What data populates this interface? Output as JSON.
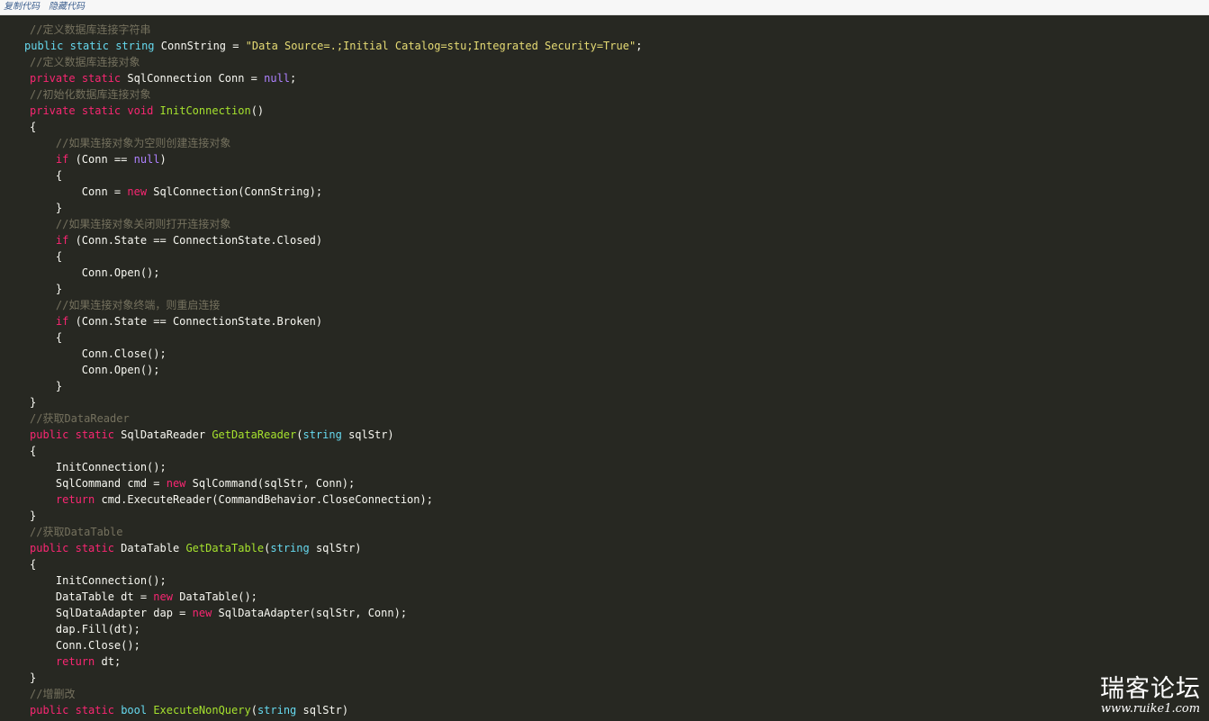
{
  "toolbar": {
    "copy_label": "复制代码",
    "hide_label": "隐藏代码"
  },
  "colors": {
    "background": "#272822",
    "keyword": "#f92672",
    "type": "#66d9ef",
    "string": "#e6db74",
    "function": "#a6e22e",
    "comment": "#75715e",
    "literal": "#ae81ff",
    "plain": "#f8f8f2"
  },
  "code": {
    "language": "csharp",
    "lines": [
      [
        [
          "cm",
          "//定义数据库连接字符串"
        ]
      ],
      [
        [
          "ty",
          "public"
        ],
        [
          "",
          " "
        ],
        [
          "ty",
          "static"
        ],
        [
          "",
          " "
        ],
        [
          "ty",
          "string"
        ],
        [
          "",
          " ConnString = "
        ],
        [
          "st",
          "\"Data Source=.;Initial Catalog=stu;Integrated Security=True\""
        ],
        [
          "",
          ";"
        ]
      ],
      [
        [
          "cm",
          "//定义数据库连接对象"
        ]
      ],
      [
        [
          "kw",
          "private"
        ],
        [
          "",
          " "
        ],
        [
          "kw",
          "static"
        ],
        [
          "",
          " SqlConnection Conn = "
        ],
        [
          "nl",
          "null"
        ],
        [
          "",
          ";"
        ]
      ],
      [
        [
          "cm",
          "//初始化数据库连接对象"
        ]
      ],
      [
        [
          "kw",
          "private"
        ],
        [
          "",
          " "
        ],
        [
          "kw",
          "static"
        ],
        [
          "",
          " "
        ],
        [
          "kw",
          "void"
        ],
        [
          "",
          " "
        ],
        [
          "fn",
          "InitConnection"
        ],
        [
          "",
          "()"
        ]
      ],
      [
        [
          "",
          "{"
        ]
      ],
      [
        [
          "",
          "    "
        ],
        [
          "cm",
          "//如果连接对象为空则创建连接对象"
        ]
      ],
      [
        [
          "",
          "    "
        ],
        [
          "kw",
          "if"
        ],
        [
          "",
          " (Conn == "
        ],
        [
          "nl",
          "null"
        ],
        [
          "",
          ")"
        ]
      ],
      [
        [
          "",
          "    {"
        ]
      ],
      [
        [
          "",
          "        Conn = "
        ],
        [
          "kw",
          "new"
        ],
        [
          "",
          " SqlConnection(ConnString);"
        ]
      ],
      [
        [
          "",
          "    }"
        ]
      ],
      [
        [
          "",
          "    "
        ],
        [
          "cm",
          "//如果连接对象关闭则打开连接对象"
        ]
      ],
      [
        [
          "",
          "    "
        ],
        [
          "kw",
          "if"
        ],
        [
          "",
          " (Conn.State == ConnectionState.Closed)"
        ]
      ],
      [
        [
          "",
          "    {"
        ]
      ],
      [
        [
          "",
          "        Conn.Open();"
        ]
      ],
      [
        [
          "",
          "    }"
        ]
      ],
      [
        [
          "",
          "    "
        ],
        [
          "cm",
          "//如果连接对象终端，则重启连接"
        ]
      ],
      [
        [
          "",
          "    "
        ],
        [
          "kw",
          "if"
        ],
        [
          "",
          " (Conn.State == ConnectionState.Broken)"
        ]
      ],
      [
        [
          "",
          "    {"
        ]
      ],
      [
        [
          "",
          "        Conn.Close();"
        ]
      ],
      [
        [
          "",
          "        Conn.Open();"
        ]
      ],
      [
        [
          "",
          "    }"
        ]
      ],
      [
        [
          "",
          "}"
        ]
      ],
      [
        [
          "cm",
          "//获取DataReader"
        ]
      ],
      [
        [
          "kw",
          "public"
        ],
        [
          "",
          " "
        ],
        [
          "kw",
          "static"
        ],
        [
          "",
          " SqlDataReader "
        ],
        [
          "fn",
          "GetDataReader"
        ],
        [
          "",
          "("
        ],
        [
          "ty",
          "string"
        ],
        [
          "",
          " sqlStr)"
        ]
      ],
      [
        [
          "",
          "{"
        ]
      ],
      [
        [
          "",
          "    InitConnection();"
        ]
      ],
      [
        [
          "",
          "    SqlCommand cmd = "
        ],
        [
          "kw",
          "new"
        ],
        [
          "",
          " SqlCommand(sqlStr, Conn);"
        ]
      ],
      [
        [
          "",
          "    "
        ],
        [
          "kw",
          "return"
        ],
        [
          "",
          " cmd.ExecuteReader(CommandBehavior.CloseConnection);"
        ]
      ],
      [
        [
          "",
          "}"
        ]
      ],
      [
        [
          "cm",
          "//获取DataTable"
        ]
      ],
      [
        [
          "kw",
          "public"
        ],
        [
          "",
          " "
        ],
        [
          "kw",
          "static"
        ],
        [
          "",
          " DataTable "
        ],
        [
          "fn",
          "GetDataTable"
        ],
        [
          "",
          "("
        ],
        [
          "ty",
          "string"
        ],
        [
          "",
          " sqlStr)"
        ]
      ],
      [
        [
          "",
          "{"
        ]
      ],
      [
        [
          "",
          "    InitConnection();"
        ]
      ],
      [
        [
          "",
          "    DataTable dt = "
        ],
        [
          "kw",
          "new"
        ],
        [
          "",
          " DataTable();"
        ]
      ],
      [
        [
          "",
          "    SqlDataAdapter dap = "
        ],
        [
          "kw",
          "new"
        ],
        [
          "",
          " SqlDataAdapter(sqlStr, Conn);"
        ]
      ],
      [
        [
          "",
          "    dap.Fill(dt);"
        ]
      ],
      [
        [
          "",
          "    Conn.Close();"
        ]
      ],
      [
        [
          "",
          "    "
        ],
        [
          "kw",
          "return"
        ],
        [
          "",
          " dt;"
        ]
      ],
      [
        [
          "",
          "}"
        ]
      ],
      [
        [
          "cm",
          "//增删改"
        ]
      ],
      [
        [
          "kw",
          "public"
        ],
        [
          "",
          " "
        ],
        [
          "kw",
          "static"
        ],
        [
          "",
          " "
        ],
        [
          "ty",
          "bool"
        ],
        [
          "",
          " "
        ],
        [
          "fn",
          "ExecuteNonQuery"
        ],
        [
          "",
          "("
        ],
        [
          "ty",
          "string"
        ],
        [
          "",
          " sqlStr)"
        ]
      ]
    ]
  },
  "watermark": {
    "title": "瑞客论坛",
    "url": "www.ruike1.com"
  }
}
